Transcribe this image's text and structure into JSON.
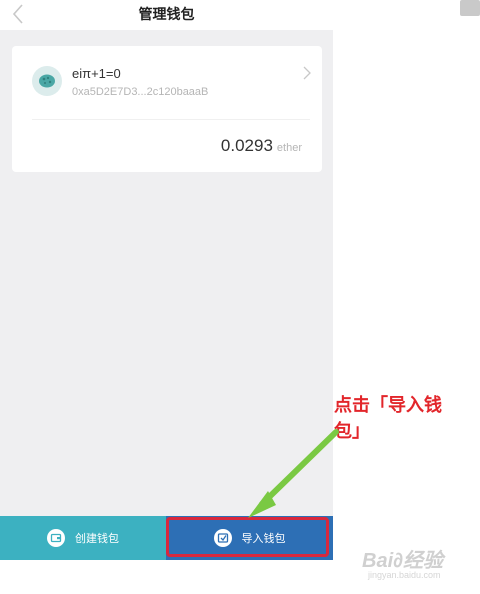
{
  "nav": {
    "title": "管理钱包"
  },
  "wallet": {
    "name": "eiπ+1=0",
    "address": "0xa5D2E7D3...2c120baaaB",
    "balance": "0.0293",
    "unit": "ether"
  },
  "buttons": {
    "create_label": "创建钱包",
    "import_label": "导入钱包"
  },
  "annotation": {
    "line1": "点击「导入钱",
    "line2": "包」"
  },
  "watermark": {
    "logo": "Bai∂经验",
    "sub": "jingyan.baidu.com"
  },
  "colors": {
    "create_bg": "#3cb1c1",
    "import_bg": "#2d6fb5",
    "highlight": "#d8283d",
    "arrow": "#7ac943",
    "annotation": "#e2262b"
  },
  "icons": [
    "back-icon",
    "wallet-avatar-icon",
    "chevron-right-icon",
    "wallet-icon",
    "import-icon",
    "corner-icon"
  ]
}
